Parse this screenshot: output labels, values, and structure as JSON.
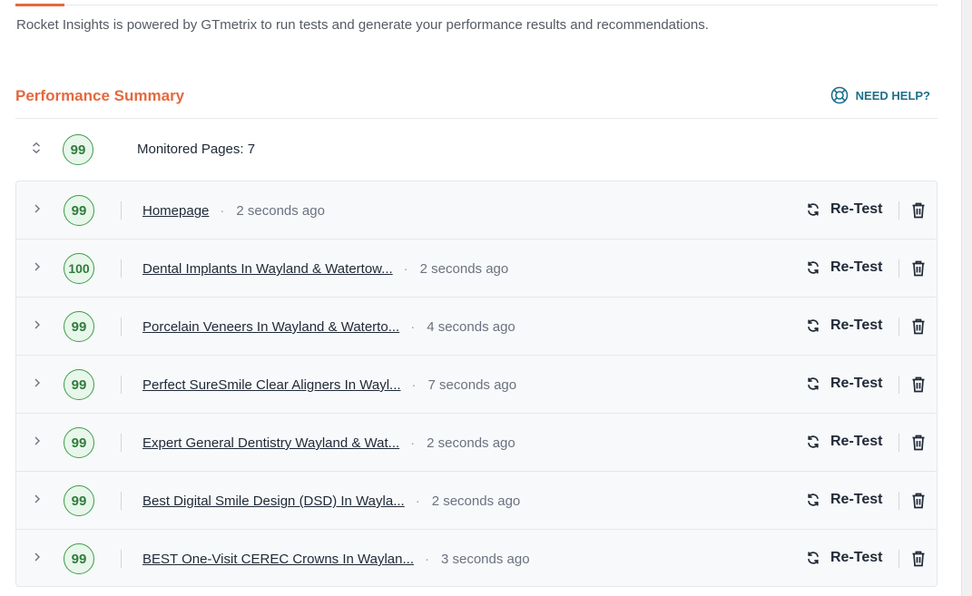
{
  "intro_text": "Rocket Insights is powered by GTmetrix to run tests and generate your performance results and recommendations.",
  "summary": {
    "title": "Performance Summary",
    "need_help_label": "NEED HELP?",
    "overall_score": "99",
    "monitored_label": "Monitored Pages: 7"
  },
  "row_actions": {
    "retest_label": "Re-Test"
  },
  "colors": {
    "accent": "#e4693f",
    "score_green": "#2f7d3b",
    "help_blue": "#1f6f8b"
  },
  "pages": [
    {
      "score": "99",
      "title": "Homepage",
      "time": "2 seconds ago"
    },
    {
      "score": "100",
      "title": "Dental Implants In Wayland & Watertow...",
      "time": "2 seconds ago"
    },
    {
      "score": "99",
      "title": "Porcelain Veneers In Wayland & Waterto...",
      "time": "4 seconds ago"
    },
    {
      "score": "99",
      "title": "Perfect SureSmile Clear Aligners In Wayl...",
      "time": "7 seconds ago"
    },
    {
      "score": "99",
      "title": "Expert General Dentistry Wayland & Wat...",
      "time": "2 seconds ago"
    },
    {
      "score": "99",
      "title": "Best Digital Smile Design (DSD) In Wayla...",
      "time": "2 seconds ago"
    },
    {
      "score": "99",
      "title": "BEST One-Visit CEREC Crowns In Waylan...",
      "time": "3 seconds ago"
    }
  ]
}
